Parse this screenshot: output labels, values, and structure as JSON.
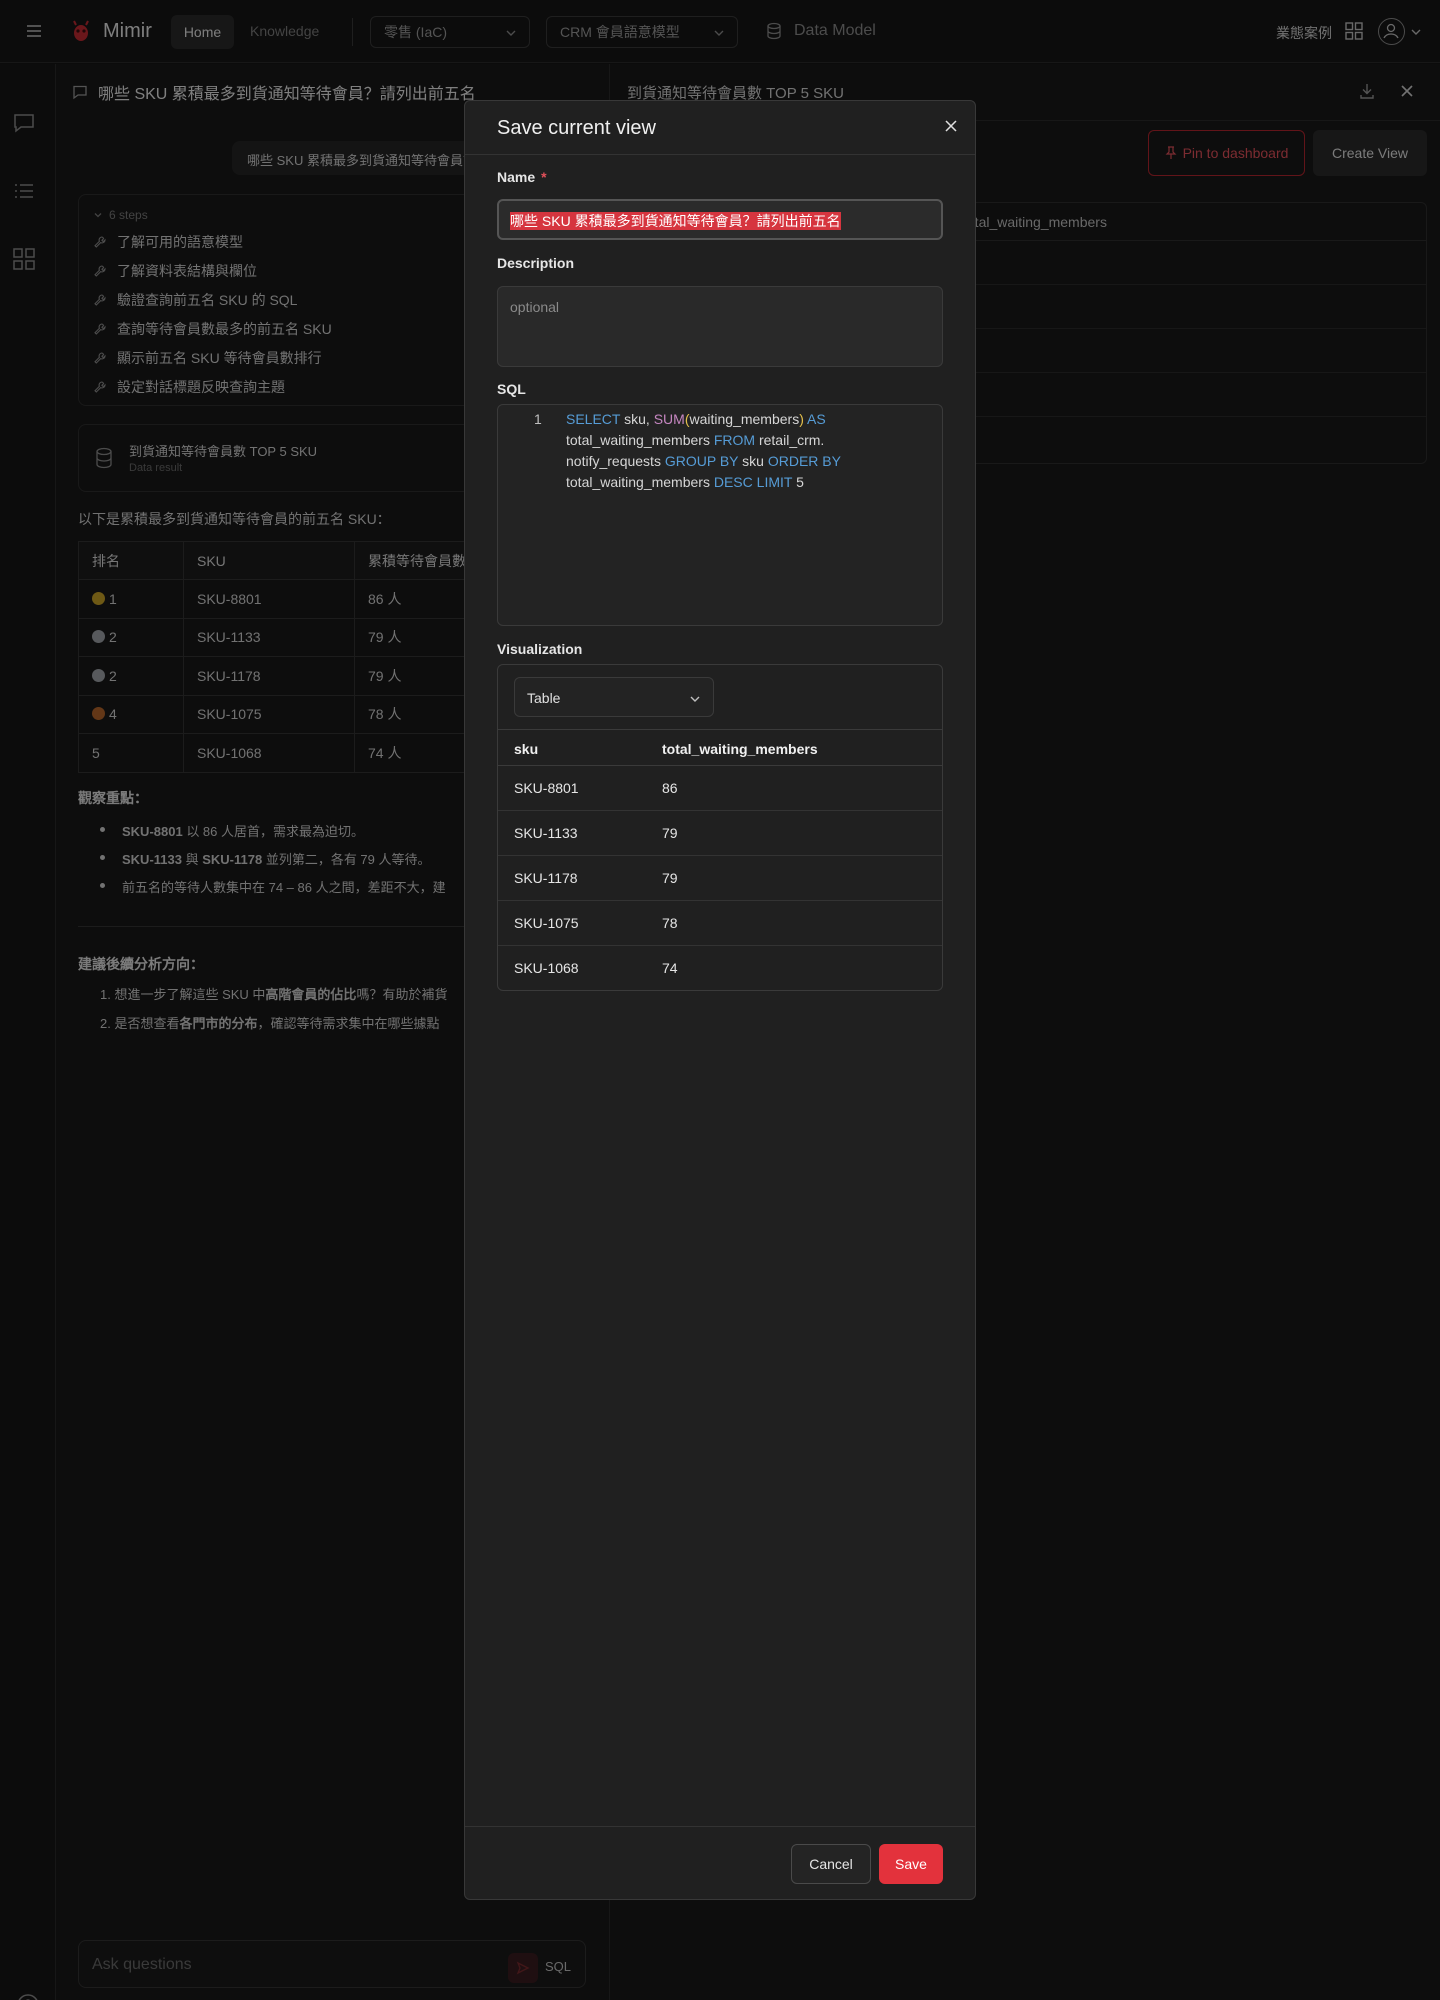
{
  "app": {
    "brand": "Mimir",
    "nav": {
      "home": "Home",
      "knowledge": "Knowledge"
    },
    "project_select": "零售 (IaC)",
    "model_select": "CRM 會員語意模型",
    "data_model_label": "Data Model",
    "case_label": "業態案例",
    "brand_color": "#e3323c"
  },
  "chat": {
    "title": "哪些 SKU 累積最多到貨通知等待會員？請列出前五名",
    "user_message": "哪些 SKU 累積最多到貨通知等待會員？請列出前五名",
    "steps_header": "6 steps",
    "steps": [
      "了解可用的語意模型",
      "了解資料表結構與欄位",
      "驗證查詢前五名 SKU 的 SQL",
      "查詢等待會員數最多的前五名 SKU",
      "顯示前五名 SKU 等待會員數排行",
      "設定對話標題反映查詢主題"
    ],
    "result_card": {
      "title": "到貨通知等待會員數 TOP 5 SKU",
      "subtitle": "Data result"
    },
    "intro": "以下是累積最多到貨通知等待會員的前五名 SKU：",
    "table": {
      "headers": [
        "排名",
        "SKU",
        "累積等待會員數"
      ],
      "rows": [
        {
          "rank": "1",
          "sku": "SKU-8801",
          "count": "86 人",
          "medal": "#c9a227"
        },
        {
          "rank": "2",
          "sku": "SKU-1133",
          "count": "79 人",
          "medal": "#9ea3a8"
        },
        {
          "rank": "2",
          "sku": "SKU-1178",
          "count": "79 人",
          "medal": "#9ea3a8"
        },
        {
          "rank": "4",
          "sku": "SKU-1075",
          "count": "78 人",
          "medal": "#b5652a"
        },
        {
          "rank": "5",
          "sku": "SKU-1068",
          "count": "74 人",
          "medal": ""
        }
      ]
    },
    "observations_title": "觀察重點：",
    "observations": [
      {
        "bold1": "SKU-8801",
        "text1": " 以 86 人居首，需求最為迫切。",
        "bold2": "",
        "text2": ""
      },
      {
        "bold1": "SKU-1133",
        "text1": " 與 ",
        "bold2": "SKU-1178",
        "text2": " 並列第二，各有 79 人等待。"
      },
      {
        "bold1": "",
        "text1": "前五名的等待人數集中在 74 – 86 人之間，差距不大，建",
        "bold2": "",
        "text2": ""
      }
    ],
    "suggestions_title": "建議後續分析方向：",
    "suggestions": [
      {
        "prefix": "1. 想進一步了解這些 SKU 中",
        "bold": "高階會員的佔比",
        "suffix": "嗎？有助於補貨"
      },
      {
        "prefix": "2. 是否想查看",
        "bold": "各門市的分布",
        "suffix": "，確認等待需求集中在哪些據點"
      }
    ],
    "input_placeholder": "Ask questions",
    "sql_label": "SQL"
  },
  "right_panel": {
    "title": "到貨通知等待會員數 TOP 5 SKU",
    "pin_label": "Pin to dashboard",
    "create_view_label": "Create View",
    "table_header_col2": "total_waiting_members"
  },
  "modal": {
    "title": "Save current view",
    "name_label": "Name",
    "required_mark": "*",
    "name_value": "哪些 SKU 累積最多到貨通知等待會員？請列出前五名",
    "description_label": "Description",
    "description_placeholder": "optional",
    "sql_label": "SQL",
    "sql_line_number": "1",
    "sql_tokens": {
      "select": "SELECT",
      "sku_comma": " sku, ",
      "sum": "SUM",
      "open": "(",
      "arg": "waiting_members",
      "close": ")",
      "as": " AS",
      "alias": "total_waiting_members ",
      "from": "FROM",
      "table1": " retail_crm.",
      "table2": "notify_requests ",
      "group_by": "GROUP BY",
      "sku2": " sku ",
      "order_by": "ORDER BY",
      "alias2": "total_waiting_members ",
      "desc": "DESC",
      "limit": " LIMIT",
      "limit_val": " 5"
    },
    "visualization_label": "Visualization",
    "viz_type": "Table",
    "viz_table": {
      "headers": [
        "sku",
        "total_waiting_members"
      ],
      "rows": [
        [
          "SKU-8801",
          "86"
        ],
        [
          "SKU-1133",
          "79"
        ],
        [
          "SKU-1178",
          "79"
        ],
        [
          "SKU-1075",
          "78"
        ],
        [
          "SKU-1068",
          "74"
        ]
      ]
    },
    "cancel_label": "Cancel",
    "save_label": "Save"
  }
}
